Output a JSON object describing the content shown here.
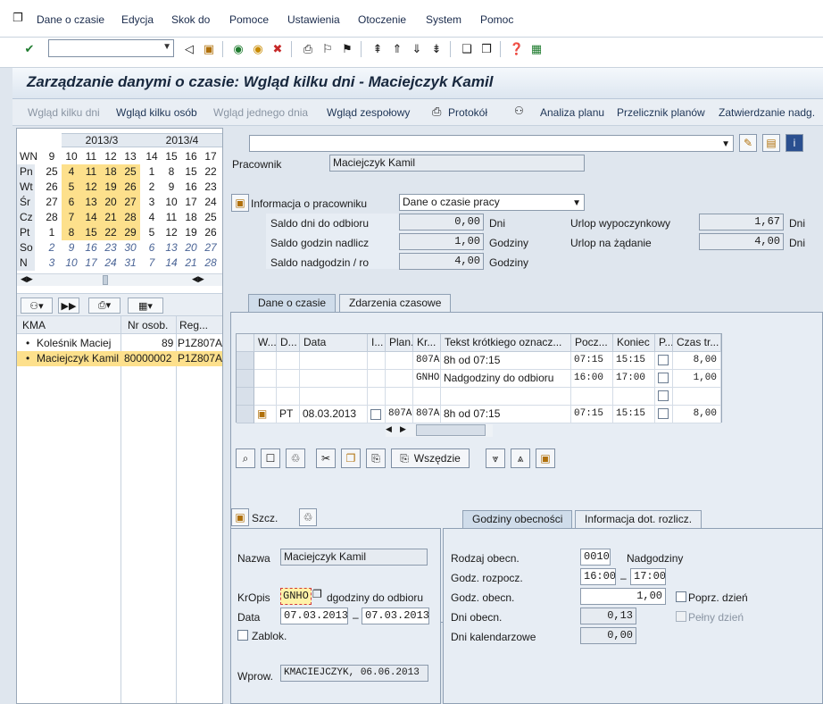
{
  "menu": {
    "items": [
      "Dane o czasie",
      "Edycja",
      "Skok do",
      "Pomoce",
      "Ustawienia",
      "Otoczenie",
      "System",
      "Pomoc"
    ]
  },
  "toolbar": {
    "command_value": ""
  },
  "title": "Zarządzanie danymi o czasie: Wgląd kilku dni - Maciejczyk Kamil",
  "app_toolbar": {
    "buttons": [
      {
        "label": "Wgląd kilku dni",
        "enabled": false
      },
      {
        "label": "Wgląd kilku osób",
        "enabled": true
      },
      {
        "label": "Wgląd jednego dnia",
        "enabled": false
      },
      {
        "label": "Wgląd zespołowy",
        "enabled": true
      },
      {
        "label": "Protokół",
        "enabled": true
      },
      {
        "label": "Analiza planu",
        "enabled": true
      },
      {
        "label": "Przelicznik planów",
        "enabled": true
      },
      {
        "label": "Zatwierdzanie nadg.",
        "enabled": true
      }
    ]
  },
  "calendar": {
    "months": [
      "2013/3",
      "2013/4"
    ],
    "header": [
      "WN",
      "9",
      "10",
      "11",
      "12",
      "13",
      "14",
      "15",
      "16",
      "17"
    ],
    "rows": [
      {
        "day": "Pn",
        "cells": [
          "25",
          "4",
          "11",
          "18",
          "25",
          "1",
          "8",
          "15",
          "22"
        ]
      },
      {
        "day": "Wt",
        "cells": [
          "26",
          "5",
          "12",
          "19",
          "26",
          "2",
          "9",
          "16",
          "23"
        ]
      },
      {
        "day": "Śr",
        "cells": [
          "27",
          "6",
          "13",
          "20",
          "27",
          "3",
          "10",
          "17",
          "24"
        ]
      },
      {
        "day": "Cz",
        "cells": [
          "28",
          "7",
          "14",
          "21",
          "28",
          "4",
          "11",
          "18",
          "25"
        ]
      },
      {
        "day": "Pt",
        "cells": [
          "1",
          "8",
          "15",
          "22",
          "29",
          "5",
          "12",
          "19",
          "26"
        ]
      },
      {
        "day": "So",
        "cells": [
          "2",
          "9",
          "16",
          "23",
          "30",
          "6",
          "13",
          "20",
          "27"
        ]
      },
      {
        "day": "N",
        "cells": [
          "3",
          "10",
          "17",
          "24",
          "31",
          "7",
          "14",
          "21",
          "28"
        ]
      }
    ]
  },
  "employee_list": {
    "headers": [
      "KMA",
      "Nr osob.",
      "Reg..."
    ],
    "rows": [
      {
        "name": "Koleśnik Maciej",
        "nr": "89",
        "reg": "P1Z807A",
        "selected": false
      },
      {
        "name": "Maciejczyk Kamil",
        "nr": "80000002",
        "reg": "P1Z807A",
        "selected": true
      }
    ]
  },
  "employee": {
    "label": "Pracownik",
    "name": "Maciejczyk Kamil",
    "info_label": "Informacja o pracowniku",
    "info_select": "Dane o czasie pracy"
  },
  "balances": {
    "left": [
      {
        "label": "Saldo dni do odbioru",
        "value": "0,00",
        "unit": "Dni"
      },
      {
        "label": "Saldo godzin nadlicz",
        "value": "1,00",
        "unit": "Godziny"
      },
      {
        "label": "Saldo nadgodzin / ro",
        "value": "4,00",
        "unit": "Godziny"
      }
    ],
    "right": [
      {
        "label": "Urlop wypoczynkowy",
        "value": "1,67",
        "unit": "Dni"
      },
      {
        "label": "Urlop na żądanie",
        "value": "4,00",
        "unit": "Dni"
      }
    ]
  },
  "tabs_top": [
    "Dane o czasie",
    "Zdarzenia czasowe"
  ],
  "table": {
    "headers": [
      "W...",
      "D...",
      "Data",
      "I...",
      "Plan.",
      "Kr...",
      "Tekst krótkiego oznacz...",
      "Pocz...",
      "Koniec",
      "P...",
      "Czas tr..."
    ],
    "rows": [
      {
        "d": "",
        "date": "",
        "plan": "",
        "kr": "807A",
        "text": "8h od 07:15",
        "start": "07:15",
        "end": "15:15",
        "checkbox": true,
        "hours": "8,00",
        "icon": false
      },
      {
        "d": "",
        "date": "",
        "plan": "",
        "kr": "GNHO",
        "text": "Nadgodziny do odbioru",
        "start": "16:00",
        "end": "17:00",
        "checkbox": true,
        "hours": "1,00",
        "icon": false
      },
      {
        "d": "",
        "date": "",
        "plan": "",
        "kr": "",
        "text": "",
        "start": "",
        "end": "",
        "checkbox": true,
        "hours": "",
        "icon": false
      },
      {
        "d": "PT",
        "date": "08.03.2013",
        "plan": "807A",
        "kr": "807A",
        "text": "8h od 07:15",
        "start": "07:15",
        "end": "15:15",
        "checkbox": true,
        "hours": "8,00",
        "icon": true
      }
    ]
  },
  "table_toolbar": {
    "everywhere_label": "Wszędzie"
  },
  "detail": {
    "szcz_label": "Szcz.",
    "name_label": "Nazwa",
    "name_value": "Maciejczyk Kamil",
    "kropis_label": "KrOpis",
    "kropis_code": "GNHO",
    "kropis_text": "dgodziny do odbioru",
    "date_label": "Data",
    "date_from": "07.03.2013",
    "date_to": "07.03.2013",
    "blocked_label": "Zablok.",
    "entered_label": "Wprow.",
    "entered_value": "KMACIEJCZYK, 06.06.2013"
  },
  "tabs_bottom": [
    "Godziny obecności",
    "Informacja dot. rozlicz."
  ],
  "attendance": {
    "type_label": "Rodzaj obecn.",
    "type_code": "0010",
    "type_text": "Nadgodziny",
    "start_label": "Godz. rozpocz.",
    "start_from": "16:00",
    "start_to": "17:00",
    "hours_label": "Godz. obecn.",
    "hours_value": "1,00",
    "prev_day_label": "Poprz. dzień",
    "days_label": "Dni obecn.",
    "days_value": "0,13",
    "full_day_label": "Pełny dzień",
    "cal_days_label": "Dni kalendarzowe",
    "cal_days_value": "0,00"
  },
  "colors": {
    "selection": "#fde08c",
    "background": "#dfe6ee"
  }
}
